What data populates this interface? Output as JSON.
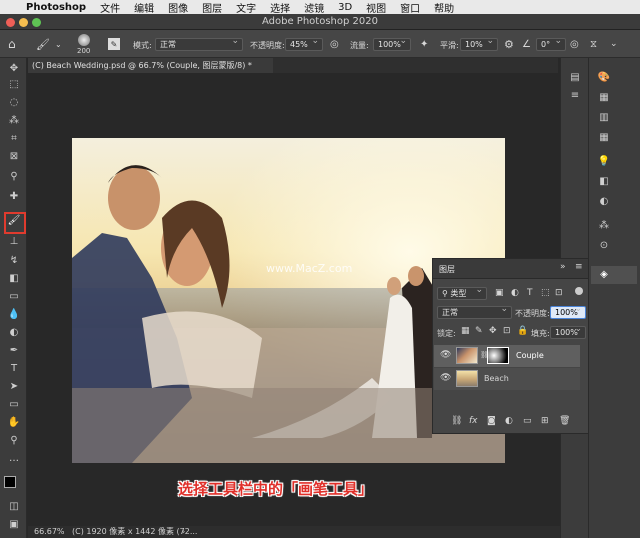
{
  "menubar": {
    "app": "Photoshop",
    "items": [
      "文件",
      "编辑",
      "图像",
      "图层",
      "文字",
      "选择",
      "滤镜",
      "3D",
      "视图",
      "窗口",
      "帮助"
    ]
  },
  "window": {
    "title": "Adobe Photoshop 2020"
  },
  "options": {
    "brush_size": "200",
    "mode_label": "模式:",
    "mode_value": "正常",
    "opacity_label": "不透明度:",
    "opacity_value": "45%",
    "flow_label": "流量:",
    "flow_value": "100%",
    "smoothing_label": "平滑:",
    "smoothing_value": "10%",
    "angle_value": "0°"
  },
  "document": {
    "tab_title": "(C) Beach Wedding.psd @ 66.7% (Couple, 图层蒙版/8) *"
  },
  "layers_panel": {
    "title": "图层",
    "filter_label": "类型",
    "blend_mode": "正常",
    "opacity_label": "不透明度:",
    "opacity_value": "100%",
    "lock_label": "锁定:",
    "fill_label": "填充:",
    "fill_value": "100%",
    "layers": [
      {
        "name": "Couple",
        "selected": true,
        "has_mask": true
      },
      {
        "name": "Beach",
        "selected": false,
        "has_mask": false
      }
    ]
  },
  "status": {
    "zoom": "66.67%",
    "info": "(C) 1920 像素 x 1442 像素 (72..."
  },
  "watermark": "www.MacZ.com",
  "caption": "选择工具栏中的「画笔工具」",
  "colors": {
    "highlight": "#e03b2e",
    "caption": "#e0302a",
    "panel_bg": "#454545",
    "app_bg": "#282828"
  }
}
